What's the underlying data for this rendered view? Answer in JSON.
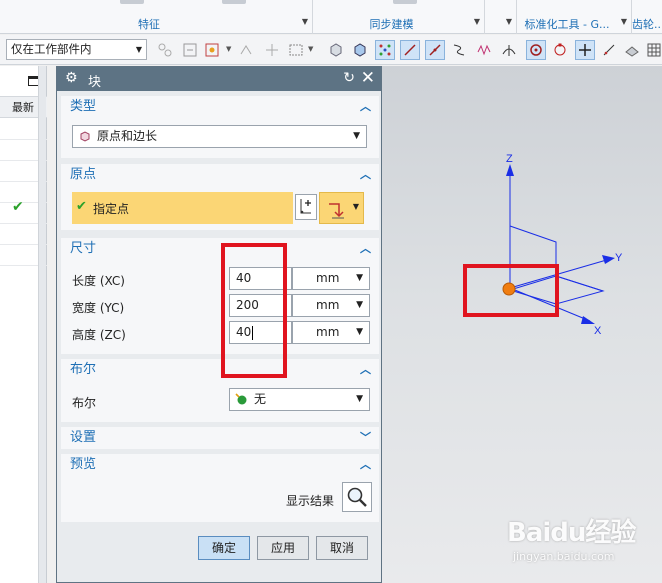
{
  "ribbon": {
    "groups": [
      {
        "label": "特征"
      },
      {
        "label": "同步建模"
      },
      {
        "label": "标准化工具 - G..."
      },
      {
        "label": "齿轮..."
      }
    ]
  },
  "toolbar": {
    "scope_filter": "仅在工作部件内"
  },
  "part_navigator": {
    "column_header": "最新"
  },
  "dialog": {
    "title": "块",
    "sections": {
      "type": {
        "header": "类型",
        "selected": "原点和边长"
      },
      "origin": {
        "header": "原点",
        "specify_point": "指定点"
      },
      "dimensions": {
        "header": "尺寸",
        "rows": [
          {
            "label": "长度 (XC)",
            "value": "40",
            "unit": "mm"
          },
          {
            "label": "宽度 (YC)",
            "value": "200",
            "unit": "mm"
          },
          {
            "label": "高度 (ZC)",
            "value": "40",
            "unit": "mm"
          }
        ]
      },
      "boolean": {
        "header": "布尔",
        "label": "布尔",
        "selected": "无"
      },
      "settings": {
        "header": "设置"
      },
      "preview": {
        "header": "预览",
        "show_result": "显示结果"
      }
    },
    "buttons": {
      "ok": "确定",
      "apply": "应用",
      "cancel": "取消"
    }
  },
  "viewport": {
    "axis_labels": {
      "z": "Z",
      "y": "Y",
      "x": "X"
    },
    "colors": {
      "axis": "#1a2ee6",
      "origin": "#f07d10"
    }
  },
  "watermark": {
    "brand": "Baidu经验",
    "url": "jingyan.baidu.com"
  }
}
